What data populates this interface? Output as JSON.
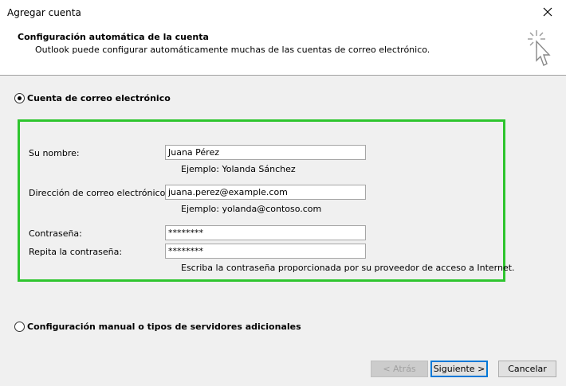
{
  "window": {
    "title": "Agregar cuenta"
  },
  "header": {
    "title": "Configuración automática de la cuenta",
    "subtitle": "Outlook puede configurar automáticamente muchas de las cuentas de correo electrónico."
  },
  "options": {
    "email_account": {
      "label": "Cuenta de correo electrónico",
      "selected": true
    },
    "manual": {
      "label": "Configuración manual o tipos de servidores adicionales",
      "selected": false
    }
  },
  "form": {
    "name": {
      "label": "Su nombre:",
      "value": "Juana Pérez",
      "hint": "Ejemplo: Yolanda Sánchez"
    },
    "email": {
      "label": "Dirección de correo electrónico:",
      "value": "juana.perez@example.com",
      "hint": "Ejemplo: yolanda@contoso.com"
    },
    "password": {
      "label": "Contraseña:",
      "value": "********"
    },
    "password_repeat": {
      "label": "Repita la contraseña:",
      "value": "********"
    },
    "password_hint": "Escriba la contraseña proporcionada por su proveedor de acceso a Internet."
  },
  "buttons": {
    "back": "< Atrás",
    "next": "Siguiente >",
    "cancel": "Cancelar"
  },
  "colors": {
    "highlight_border": "#2ec52e",
    "dialog_bg": "#f0f0f0"
  },
  "icons": {
    "close": "close-icon",
    "wizard": "magic-wand-cursor-icon"
  }
}
